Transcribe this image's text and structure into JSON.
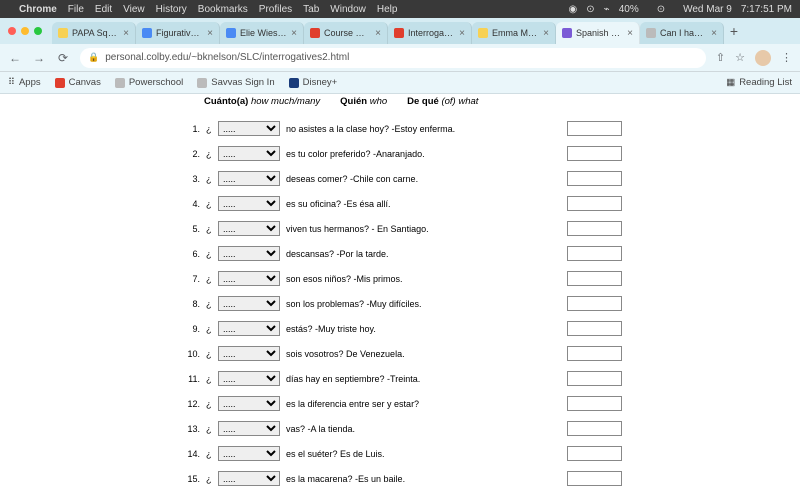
{
  "mac_menu": {
    "apple": "",
    "items": [
      "Chrome",
      "File",
      "Edit",
      "View",
      "History",
      "Bookmarks",
      "Profiles",
      "Tab",
      "Window",
      "Help"
    ],
    "status": {
      "siri": "◉",
      "search": "⊙",
      "toggle": "⌁",
      "battery": "40%",
      "bt": "",
      "wifi": "⊙",
      "vol": "",
      "date": "Wed Mar 9",
      "time": "7:17:51 PM"
    }
  },
  "tabs": [
    {
      "label": "PAPA Square Fin…",
      "fav": "fv-yellow"
    },
    {
      "label": "Figurative Langu…",
      "fav": "fv-blue"
    },
    {
      "label": "Elie Wiesel Nobe…",
      "fav": "fv-blue"
    },
    {
      "label": "Course Modules:",
      "fav": "fv-canvas"
    },
    {
      "label": "Interrogative Pra…",
      "fav": "fv-canvas"
    },
    {
      "label": "Emma Marty - Pr…",
      "fav": "fv-yellow"
    },
    {
      "label": "Spanish Languag…",
      "fav": "fv-purple",
      "active": true
    },
    {
      "label": "Can I have help s…",
      "fav": "fv-generic"
    }
  ],
  "newtab": "+",
  "toolbar": {
    "back": "←",
    "fwd": "→",
    "reload": "⟳",
    "lock": "🔒",
    "url": "personal.colby.edu/~bknelson/SLC/interrogatives2.html",
    "share": "⇧",
    "star": "☆",
    "menu": "⋮"
  },
  "bookmarks": {
    "apps_ico": "⠿",
    "apps": "Apps",
    "items": [
      {
        "label": "Canvas",
        "cls": "fv-canvas"
      },
      {
        "label": "Powerschool",
        "cls": "fv-generic"
      },
      {
        "label": "Savvas Sign In",
        "cls": "fv-generic"
      },
      {
        "label": "Disney+",
        "cls": "fv-disney"
      }
    ],
    "reading": "Reading List",
    "reading_ico": "▦"
  },
  "page_header": [
    {
      "b": "Cuánto(a)",
      "i": "how much/many"
    },
    {
      "b": "Quién",
      "i": "who"
    },
    {
      "b": "De qué",
      "i": "(of) what"
    }
  ],
  "select_placeholder": ".....",
  "questions": [
    {
      "n": "1.",
      "s": "no asistes a la clase hoy? -Estoy enferma."
    },
    {
      "n": "2.",
      "s": "es tu color preferido? -Anaranjado."
    },
    {
      "n": "3.",
      "s": "deseas comer? -Chile con carne."
    },
    {
      "n": "4.",
      "s": "es su oficina? -Es ésa allí."
    },
    {
      "n": "5.",
      "s": "viven tus hermanos? - En Santiago."
    },
    {
      "n": "6.",
      "s": "descansas? -Por la tarde."
    },
    {
      "n": "7.",
      "s": "son esos niños? -Mis primos."
    },
    {
      "n": "8.",
      "s": "son los problemas? -Muy difíciles."
    },
    {
      "n": "9.",
      "s": "estás? -Muy triste hoy."
    },
    {
      "n": "10.",
      "s": "sois vosotros? De Venezuela."
    },
    {
      "n": "11.",
      "s": "días hay en septiembre? -Treinta."
    },
    {
      "n": "12.",
      "s": "es la diferencia entre ser y estar?"
    },
    {
      "n": "13.",
      "s": "vas? -A la tienda."
    },
    {
      "n": "14.",
      "s": "es el suéter? Es de Luis."
    },
    {
      "n": "15.",
      "s": "es la macarena? -Es un baile."
    }
  ],
  "inverted_q": "¿"
}
